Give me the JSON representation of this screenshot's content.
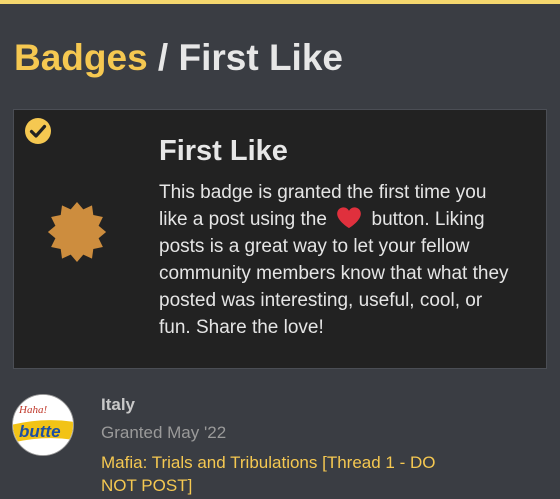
{
  "colors": {
    "accent": "#f5c851",
    "background": "#3a3d43",
    "card_background": "#222222",
    "badge_bronze": "#cd8d3e",
    "heart": "#e0303d"
  },
  "breadcrumb": {
    "root_label": "Badges",
    "separator": " / ",
    "current_label": "First Like"
  },
  "badge": {
    "title": "First Like",
    "description_before_icon": "This badge is granted the first time you like a post using the ",
    "inline_icon": "heart-icon",
    "description_after_icon": " button. Liking posts is a great way to let your fellow community members know that what they posted was interesting, useful, cool, or fun. Share the love!",
    "status_icon": "check-circle-icon",
    "badge_icon": "badge-bronze-starburst-icon"
  },
  "grant": {
    "username": "Italy",
    "granted_text": "Granted May '22",
    "topic_title": "Mafia: Trials and Tribulations [Thread 1 - DO NOT POST]",
    "avatar_icon": "butter-logo-avatar",
    "avatar_text": "Haha!",
    "avatar_brand": "butte"
  }
}
